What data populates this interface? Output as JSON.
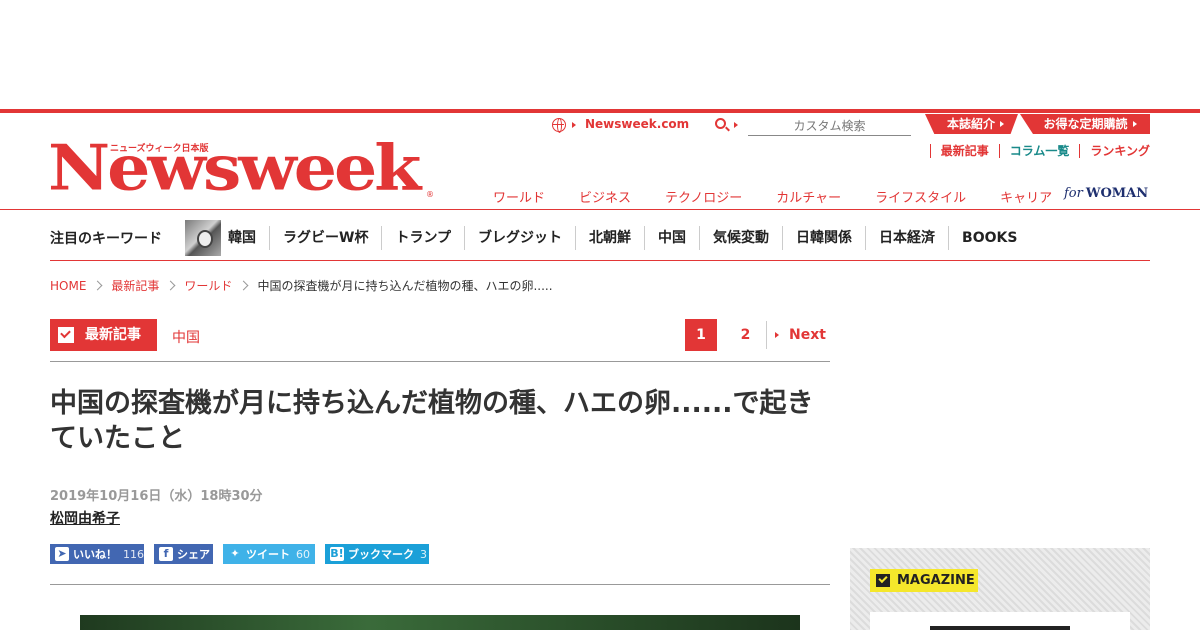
{
  "header": {
    "site_link": "Newsweek.com",
    "search_placeholder": "カスタム検索",
    "top_tabs": [
      "本誌紹介",
      "お得な定期購読"
    ],
    "sub_links": [
      "最新記事",
      "コラム一覧",
      "ランキング"
    ],
    "logo_sub": "ニューズウィーク日本版",
    "logo": "Newsweek",
    "logo_reg": "®",
    "nav": [
      "ワールド",
      "ビジネス",
      "テクノロジー",
      "カルチャー",
      "ライフスタイル",
      "キャリア"
    ],
    "for_woman": {
      "for": "for",
      "woman": "WOMAN"
    }
  },
  "keywords": {
    "title": "注目のキーワード",
    "items": [
      "韓国",
      "ラグビーW杯",
      "トランプ",
      "ブレグジット",
      "北朝鮮",
      "中国",
      "気候変動",
      "日韓関係",
      "日本経済",
      "BOOKS"
    ]
  },
  "breadcrumb": [
    "HOME",
    "最新記事",
    "ワールド",
    "中国の探査機が月に持ち込んだ植物の種、ハエの卵....."
  ],
  "category": {
    "label": "最新記事",
    "sub": "中国"
  },
  "pager": {
    "current": "1",
    "next_page": "2",
    "next_label": "Next"
  },
  "article": {
    "headline": "中国の探査機が月に持ち込んだ植物の種、ハエの卵......で起きていたこと",
    "date": "2019年10月16日（水）18時30分",
    "author": "松岡由希子"
  },
  "social": {
    "like": {
      "label": "いいね！",
      "count": "116"
    },
    "share": {
      "label": "シェア"
    },
    "tweet": {
      "label": "ツイート",
      "count": "60"
    },
    "hatena": {
      "label": "ブックマーク",
      "count": "3"
    }
  },
  "sidebar": {
    "magazine_label": "MAGAZINE"
  },
  "colors": {
    "brand": "#e23636",
    "facebook": "#4267b2",
    "twitter": "#3fb2e8",
    "magazine": "#f5e72b"
  }
}
